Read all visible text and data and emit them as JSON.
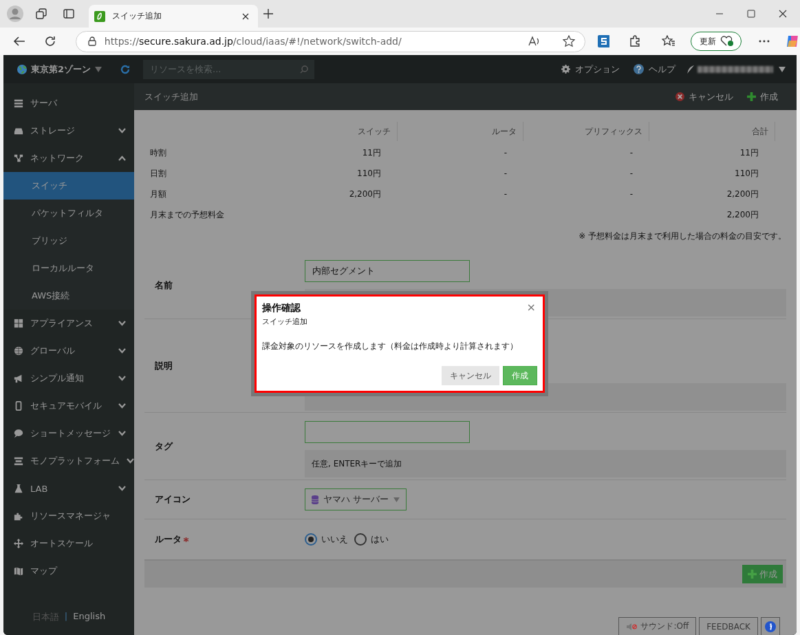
{
  "browser": {
    "tab_title": "スイッチ追加",
    "url_scheme": "https://",
    "url_host": "secure.sakura.ad.jp",
    "url_path": "/cloud/iaas/#!/network/switch-add/",
    "update_label": "更新"
  },
  "topbar": {
    "zone": "東京第2ゾーン",
    "search_placeholder": "リソースを検索...",
    "options": "オプション",
    "help": "ヘルプ"
  },
  "page_header": {
    "title": "スイッチ追加",
    "cancel": "キャンセル",
    "create": "作成"
  },
  "sidebar": {
    "items": [
      {
        "label": "サーバ",
        "kind": "link"
      },
      {
        "label": "ストレージ",
        "kind": "group",
        "expanded": false
      },
      {
        "label": "ネットワーク",
        "kind": "group",
        "expanded": true,
        "children": [
          {
            "label": "スイッチ",
            "selected": true
          },
          {
            "label": "パケットフィルタ",
            "selected": false
          },
          {
            "label": "ブリッジ",
            "selected": false
          },
          {
            "label": "ローカルルータ",
            "selected": false
          },
          {
            "label": "AWS接続",
            "selected": false
          }
        ]
      },
      {
        "label": "アプライアンス",
        "kind": "group",
        "expanded": false
      },
      {
        "label": "グローバル",
        "kind": "group",
        "expanded": false
      },
      {
        "label": "シンプル通知",
        "kind": "group",
        "expanded": false
      },
      {
        "label": "セキュアモバイル",
        "kind": "group",
        "expanded": false
      },
      {
        "label": "ショートメッセージ",
        "kind": "group",
        "expanded": false
      },
      {
        "label": "モノプラットフォーム",
        "kind": "group",
        "expanded": false
      },
      {
        "label": "LAB",
        "kind": "group",
        "expanded": false
      },
      {
        "label": "リソースマネージャ",
        "kind": "link"
      },
      {
        "label": "オートスケール",
        "kind": "link"
      },
      {
        "label": "マップ",
        "kind": "link"
      }
    ],
    "languages": [
      {
        "label": "日本語",
        "selected": true
      },
      {
        "label": "English",
        "selected": false
      }
    ],
    "language_separator": "|"
  },
  "price_table": {
    "columns": [
      "スイッチ",
      "ルータ",
      "プリフィックス",
      "合計"
    ],
    "rows": [
      {
        "label": "時割",
        "switch": "11円",
        "router": "-",
        "prefix": "-",
        "total": "11円"
      },
      {
        "label": "日割",
        "switch": "110円",
        "router": "-",
        "prefix": "-",
        "total": "110円"
      },
      {
        "label": "月額",
        "switch": "2,200円",
        "router": "-",
        "prefix": "-",
        "total": "2,200円"
      },
      {
        "label": "月末までの予想料金",
        "total": "2,200円"
      }
    ],
    "note": "※ 予想料金は月末まで利用した場合の料金の目安です。"
  },
  "form": {
    "rows": [
      {
        "label": "名前",
        "kind": "text",
        "value": "内部セグメント",
        "required": false
      },
      {
        "label": "説明",
        "kind": "textarea",
        "required": false
      },
      {
        "label": "タグ",
        "kind": "text",
        "hint": "任意, ENTERキーで追加",
        "required": false
      },
      {
        "label": "アイコン",
        "kind": "select",
        "value": "ヤマハ サーバー",
        "required": false
      },
      {
        "label": "ルータ",
        "kind": "radio",
        "required": true,
        "options": [
          {
            "label": "いいえ",
            "selected": true
          },
          {
            "label": "はい",
            "selected": false
          }
        ]
      }
    ],
    "submit": "作成"
  },
  "modal": {
    "title": "操作確認",
    "subtitle": "スイッチ追加",
    "message": "課金対象のリソースを作成します（料金は作成時より計算されます）",
    "close": "×",
    "buttons": [
      {
        "label": "キャンセル",
        "kind": "secondary"
      },
      {
        "label": "作成",
        "kind": "primary"
      }
    ]
  },
  "footer_buttons": {
    "sound": "サウンド:Off",
    "feedback": "FEEDBACK"
  }
}
